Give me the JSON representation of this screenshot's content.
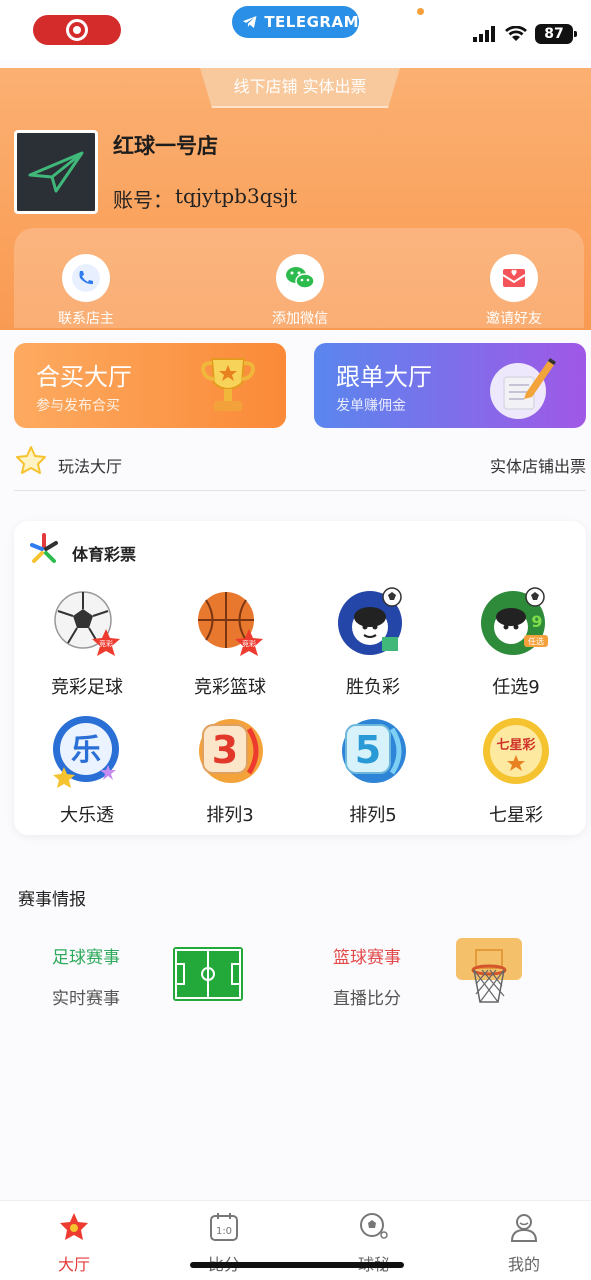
{
  "status_bar": {
    "telegram_label": "TELEGRAM",
    "battery": "87"
  },
  "header": {
    "banner": "线下店铺 实体出票",
    "store_name": "红球一号店",
    "account_label": "账号：",
    "account_value": "tqjytpb3qsjt",
    "quick_actions": [
      {
        "label": "联系店主",
        "icon": "phone-icon"
      },
      {
        "label": "添加微信",
        "icon": "wechat-icon"
      },
      {
        "label": "邀请好友",
        "icon": "invite-icon"
      }
    ]
  },
  "halls": [
    {
      "title": "合买大厅",
      "subtitle": "参与发布合买",
      "icon": "trophy-icon"
    },
    {
      "title": "跟单大厅",
      "subtitle": "发单赚佣金",
      "icon": "document-pen-icon"
    }
  ],
  "play_row": {
    "left": "玩法大厅",
    "right": "实体店铺出票"
  },
  "sports_panel": {
    "title": "体育彩票",
    "games": [
      {
        "label": "竞彩足球",
        "icon": "soccer-ball-icon"
      },
      {
        "label": "竞彩篮球",
        "icon": "basketball-icon"
      },
      {
        "label": "胜负彩",
        "icon": "win-lose-icon"
      },
      {
        "label": "任选9",
        "icon": "pick9-icon"
      },
      {
        "label": "大乐透",
        "icon": "daletou-icon"
      },
      {
        "label": "排列3",
        "icon": "pailie3-icon"
      },
      {
        "label": "排列5",
        "icon": "pailie5-icon"
      },
      {
        "label": "七星彩",
        "icon": "qixingcai-icon"
      }
    ],
    "icon_text": {
      "badge": "竞彩",
      "le": "乐",
      "three": "3",
      "five": "5",
      "seven": "七星彩",
      "nine": "9",
      "pick": "任选"
    }
  },
  "match_info": {
    "title": "赛事情报",
    "items": [
      {
        "title": "足球赛事",
        "subtitle": "实时赛事",
        "color": "#2eaa5c",
        "icon": "soccer-field-icon"
      },
      {
        "title": "篮球赛事",
        "subtitle": "直播比分",
        "color": "#e24a4a",
        "icon": "basketball-hoop-icon"
      }
    ]
  },
  "tabbar": {
    "tabs": [
      {
        "label": "大厅",
        "active": true
      },
      {
        "label": "比分",
        "active": false
      },
      {
        "label": "球秘",
        "active": false
      },
      {
        "label": "我的",
        "active": false
      }
    ],
    "score_icon_text": "1:0"
  },
  "colors": {
    "accent": "#e43a3a",
    "header": "#f99a52",
    "purple": "#a058e6"
  }
}
